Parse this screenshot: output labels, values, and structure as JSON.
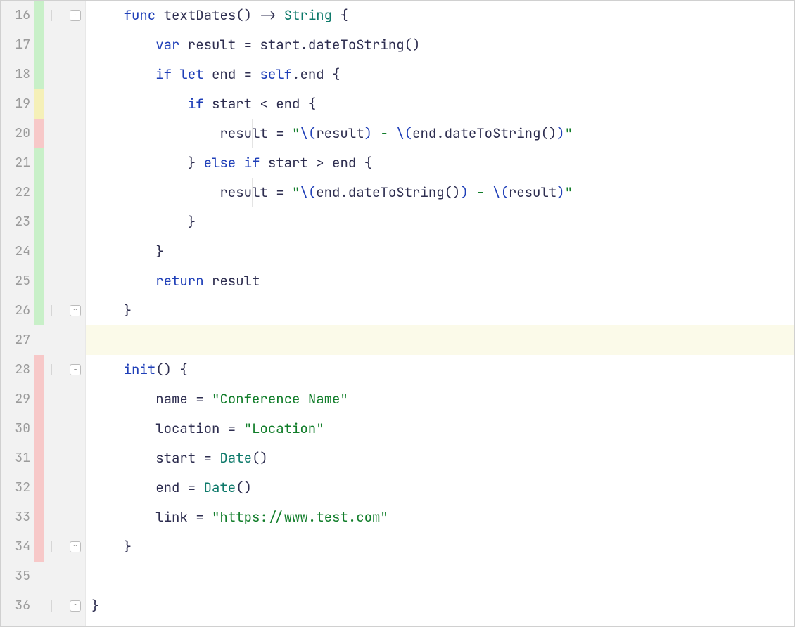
{
  "colors": {
    "keyword": "#1f3fb8",
    "type": "#0f7a6b",
    "string": "#117d2a",
    "identifier": "#2e2e50",
    "gutter_bg": "#f2f2f2",
    "vcs_green": "#c8f0c8",
    "vcs_yellow": "#f5f0b8",
    "vcs_red": "#f7c8c8",
    "highlight_bg": "#fbfae9"
  },
  "editor": {
    "first_line": 16,
    "cursor_line": 27,
    "lines": [
      {
        "num": "16",
        "vcs": "green",
        "fold": "open",
        "indent": 1,
        "tokens": [
          {
            "t": "    ",
            "c": ""
          },
          {
            "t": "func",
            "c": "tok-kw"
          },
          {
            "t": " ",
            "c": ""
          },
          {
            "t": "textDates",
            "c": "tok-fn"
          },
          {
            "t": "() -> ",
            "c": "tok-punct"
          },
          {
            "t": "String",
            "c": "tok-type"
          },
          {
            "t": " {",
            "c": "tok-punct"
          }
        ]
      },
      {
        "num": "17",
        "vcs": "green",
        "indent": 2,
        "tokens": [
          {
            "t": "        ",
            "c": ""
          },
          {
            "t": "var",
            "c": "tok-kw"
          },
          {
            "t": " result = start.",
            "c": "tok-id"
          },
          {
            "t": "dateToString",
            "c": "tok-fn"
          },
          {
            "t": "()",
            "c": "tok-punct"
          }
        ]
      },
      {
        "num": "18",
        "vcs": "green",
        "indent": 2,
        "tokens": [
          {
            "t": "        ",
            "c": ""
          },
          {
            "t": "if",
            "c": "tok-kw"
          },
          {
            "t": " ",
            "c": ""
          },
          {
            "t": "let",
            "c": "tok-kw"
          },
          {
            "t": " end = ",
            "c": "tok-id"
          },
          {
            "t": "self",
            "c": "tok-selfkw"
          },
          {
            "t": ".end {",
            "c": "tok-id"
          }
        ]
      },
      {
        "num": "19",
        "vcs": "yellow",
        "indent": 3,
        "tokens": [
          {
            "t": "            ",
            "c": ""
          },
          {
            "t": "if",
            "c": "tok-kw"
          },
          {
            "t": " start < end {",
            "c": "tok-id"
          }
        ]
      },
      {
        "num": "20",
        "vcs": "red",
        "indent": 4,
        "tokens": [
          {
            "t": "                result = ",
            "c": "tok-id"
          },
          {
            "t": "\"",
            "c": "tok-str"
          },
          {
            "t": "\\(",
            "c": "tok-interp"
          },
          {
            "t": "result",
            "c": "tok-id"
          },
          {
            "t": ")",
            "c": "tok-interp"
          },
          {
            "t": " - ",
            "c": "tok-str"
          },
          {
            "t": "\\(",
            "c": "tok-interp"
          },
          {
            "t": "end.dateToString()",
            "c": "tok-id"
          },
          {
            "t": ")",
            "c": "tok-interp"
          },
          {
            "t": "\"",
            "c": "tok-str"
          }
        ]
      },
      {
        "num": "21",
        "vcs": "green",
        "indent": 3,
        "tokens": [
          {
            "t": "            } ",
            "c": "tok-punct"
          },
          {
            "t": "else",
            "c": "tok-kw"
          },
          {
            "t": " ",
            "c": ""
          },
          {
            "t": "if",
            "c": "tok-kw"
          },
          {
            "t": " start > end {",
            "c": "tok-id"
          }
        ]
      },
      {
        "num": "22",
        "vcs": "green",
        "indent": 4,
        "tokens": [
          {
            "t": "                result = ",
            "c": "tok-id"
          },
          {
            "t": "\"",
            "c": "tok-str"
          },
          {
            "t": "\\(",
            "c": "tok-interp"
          },
          {
            "t": "end.dateToString()",
            "c": "tok-id"
          },
          {
            "t": ")",
            "c": "tok-interp"
          },
          {
            "t": " - ",
            "c": "tok-str"
          },
          {
            "t": "\\(",
            "c": "tok-interp"
          },
          {
            "t": "result",
            "c": "tok-id"
          },
          {
            "t": ")",
            "c": "tok-interp"
          },
          {
            "t": "\"",
            "c": "tok-str"
          }
        ]
      },
      {
        "num": "23",
        "vcs": "green",
        "indent": 3,
        "tokens": [
          {
            "t": "            }",
            "c": "tok-punct"
          }
        ]
      },
      {
        "num": "24",
        "vcs": "green",
        "indent": 2,
        "tokens": [
          {
            "t": "        }",
            "c": "tok-punct"
          }
        ]
      },
      {
        "num": "25",
        "vcs": "green",
        "indent": 2,
        "tokens": [
          {
            "t": "        ",
            "c": ""
          },
          {
            "t": "return",
            "c": "tok-kw"
          },
          {
            "t": " result",
            "c": "tok-id"
          }
        ]
      },
      {
        "num": "26",
        "vcs": "green",
        "fold": "close",
        "indent": 1,
        "tokens": [
          {
            "t": "    }",
            "c": "tok-punct"
          }
        ]
      },
      {
        "num": "27",
        "vcs": "",
        "highlight": true,
        "indent": 0,
        "tokens": []
      },
      {
        "num": "28",
        "vcs": "red",
        "fold": "open",
        "indent": 1,
        "tokens": [
          {
            "t": "    ",
            "c": ""
          },
          {
            "t": "init",
            "c": "tok-kw"
          },
          {
            "t": "() {",
            "c": "tok-punct"
          }
        ]
      },
      {
        "num": "29",
        "vcs": "red",
        "indent": 2,
        "tokens": [
          {
            "t": "        name = ",
            "c": "tok-id"
          },
          {
            "t": "\"Conference Name\"",
            "c": "tok-str"
          }
        ]
      },
      {
        "num": "30",
        "vcs": "red",
        "indent": 2,
        "tokens": [
          {
            "t": "        location = ",
            "c": "tok-id"
          },
          {
            "t": "\"Location\"",
            "c": "tok-str"
          }
        ]
      },
      {
        "num": "31",
        "vcs": "red",
        "indent": 2,
        "tokens": [
          {
            "t": "        start = ",
            "c": "tok-id"
          },
          {
            "t": "Date",
            "c": "tok-type"
          },
          {
            "t": "()",
            "c": "tok-punct"
          }
        ]
      },
      {
        "num": "32",
        "vcs": "red",
        "indent": 2,
        "tokens": [
          {
            "t": "        end = ",
            "c": "tok-id"
          },
          {
            "t": "Date",
            "c": "tok-type"
          },
          {
            "t": "()",
            "c": "tok-punct"
          }
        ]
      },
      {
        "num": "33",
        "vcs": "red",
        "indent": 2,
        "tokens": [
          {
            "t": "        link = ",
            "c": "tok-id"
          },
          {
            "t": "\"https://www.test.com\"",
            "c": "tok-str"
          }
        ]
      },
      {
        "num": "34",
        "vcs": "red",
        "fold": "close",
        "indent": 1,
        "tokens": [
          {
            "t": "    }",
            "c": "tok-punct"
          }
        ]
      },
      {
        "num": "35",
        "vcs": "",
        "indent": 0,
        "tokens": []
      },
      {
        "num": "36",
        "vcs": "",
        "fold": "close",
        "indent": 0,
        "tokens": [
          {
            "t": "}",
            "c": "tok-punct"
          }
        ]
      }
    ]
  }
}
